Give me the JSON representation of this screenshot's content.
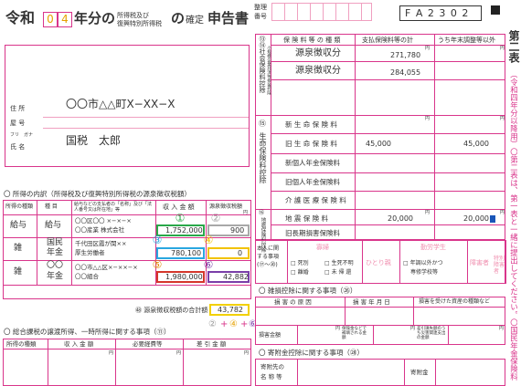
{
  "header": {
    "era": "令和",
    "year_d1": "0",
    "year_d2": "4",
    "title_pre": "年分の",
    "title_small_1": "所得税及び",
    "title_small_2": "復興特別所得税",
    "title_no": "の",
    "kakutei": "確定",
    "shinkokusho": "申告書",
    "seiri_1": "整理",
    "seiri_2": "番号",
    "form_code": "F A 2 3 0 2"
  },
  "taxpayer": {
    "jusho_label": "住 所",
    "yago_label": "屋 号",
    "furigana_label": "フリ ガナ",
    "shimei_label": "氏 名",
    "address": "〇〇市△△町X−XX−X",
    "name": "国税　太郎"
  },
  "income_section": {
    "title": "所得の内訳（所得税及び復興特別所得税の源泉徴収税額）",
    "headers": {
      "type": "所得の種類",
      "item": "種 目",
      "payer": "給与などの支払者の「名称」及び「法人番号又は所在地」等",
      "amount": "収 入 金 額",
      "withholding": "源泉徴収税額",
      "yen": "円"
    },
    "rows": [
      {
        "type": "給与",
        "item": "給与",
        "payer1": "〇〇区〇〇 ×−×−×",
        "payer2": "〇〇産業 株式会社",
        "amount": "1,752,000",
        "tax": "900",
        "num_a": "①",
        "num_b": "②"
      },
      {
        "type": "雑",
        "item": "国民年金",
        "payer1": "千代田区霞が関××",
        "payer2": "厚生労働者",
        "amount": "780,100",
        "tax": "0",
        "num_a": "③",
        "num_b": "④"
      },
      {
        "type": "雑",
        "item": "〇〇年金",
        "payer1": "〇〇市△△区×−××−×",
        "payer2": "〇〇組合",
        "amount": "1,980,000",
        "tax": "42,882",
        "num_a": "⑤",
        "num_b": "⑥"
      }
    ],
    "total_label": "㊽ 源泉徴収税額の合計額",
    "total_value": "43,782",
    "formula_a": "②",
    "formula_plus1": "+",
    "formula_b": "④",
    "formula_plus2": "+",
    "formula_c": "⑥"
  },
  "transfer_section": {
    "title": "総合課税の譲渡所得、一時所得に関する事項（⑪）",
    "headers": [
      "所得の種類",
      "収 入 金 額",
      "必要経費等",
      "差 引 金 額"
    ],
    "yen": "円"
  },
  "deduction_top": {
    "label": "⑬⑭社会保険料控除",
    "small_label": "小規模企業共済等掛金控除",
    "header_type": "保 険 料 等 の 種 類",
    "header_paid": "支払保険料等の計",
    "header_within": "うち年末調整等以外",
    "yen": "円",
    "rows": [
      {
        "name": "源泉徴収分",
        "paid": "271,780"
      },
      {
        "name": "源泉徴収分",
        "paid": "284,055"
      }
    ]
  },
  "life_insurance": {
    "num": "⑮",
    "label": "生命保険料控除",
    "rows": [
      {
        "name": "新 生 命 保 険 料",
        "paid": "",
        "within": ""
      },
      {
        "name": "旧 生 命 保 険 料",
        "paid": "45,000",
        "within": "45,000"
      },
      {
        "name": "新個人年金保険料",
        "paid": "",
        "within": ""
      },
      {
        "name": "旧個人年金保険料",
        "paid": "",
        "within": ""
      },
      {
        "name": "介 護 医 療 保 険 料",
        "paid": "",
        "within": ""
      }
    ]
  },
  "earthquake": {
    "num": "⑯",
    "label": "地震保険料控除",
    "rows": [
      {
        "name": "地 震 保 険 料",
        "paid": "20,000",
        "within": "20,000"
      },
      {
        "name": "旧長期損害保険料",
        "paid": "",
        "within": ""
      }
    ]
  },
  "personal": {
    "label_1": "本人に関",
    "label_2": "する事項",
    "label_3": "(⑰〜⑳)",
    "widow": "寡婦",
    "single": "ひとり親",
    "working_student": "勤労学生",
    "disabled": "障害者",
    "special_disabled": "特別障害者",
    "opt_dead": "死別",
    "opt_divorce": "離婚",
    "opt_alive": "生死不明",
    "opt_return": "未 帰 還",
    "opt_school": "年調以外かつ",
    "opt_school2": "専修学校等"
  },
  "casualty": {
    "title": "雑損控除に関する事項（㉖）",
    "headers": [
      "損 害 の 原 因",
      "損 害 年 月 日",
      "損害を受けた資産の種類など"
    ],
    "amount_label": "損害金額",
    "insurance_label": "保険金などで補填される金額",
    "expense_label": "差引損失額のうち災害関連支出の金額",
    "yen": "円"
  },
  "donation": {
    "title": "寄附金控除に関する事項（㉘）",
    "dest_label_1": "寄附先の",
    "dest_label_2": "名 称 等",
    "amount_label": "寄附金"
  },
  "side": {
    "tab": "第二表",
    "note": "（令和四年分以降用）〇第二表は、第一表と一緒に提出してください。〇国民年金保険料"
  }
}
